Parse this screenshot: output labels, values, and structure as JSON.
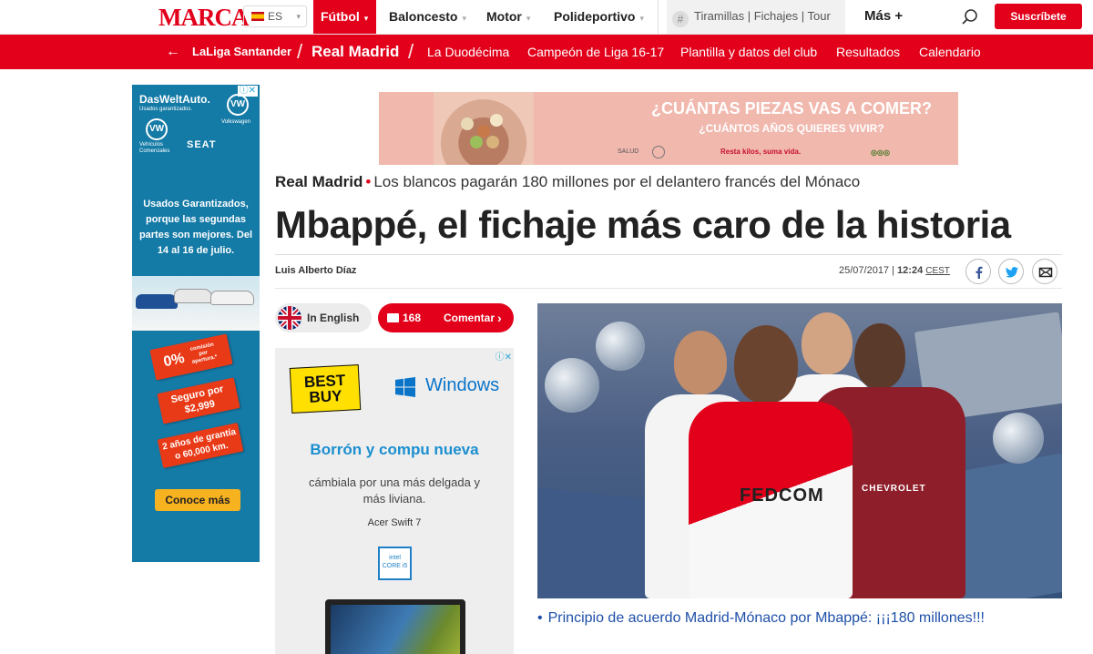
{
  "nav": {
    "logo": "MARCA",
    "lang": "ES",
    "items": [
      "Fútbol",
      "Baloncesto",
      "Motor",
      "Polideportivo"
    ],
    "trending": "Tiramillas | Fichajes | Tour",
    "more": "Más +",
    "subscribe": "Suscríbete"
  },
  "section_bar": {
    "league": "LaLiga Santander",
    "slash": "/",
    "team": "Real Madrid",
    "links": [
      "La Duodécima",
      "Campeón de Liga 16-17",
      "Plantilla y datos del club",
      "Resultados",
      "Calendario"
    ]
  },
  "ad_left": {
    "brand": "DasWeltAuto.",
    "brand_sub": "Usados garantizados.",
    "vw_logo": "VW",
    "vw_label": "Volkswagen",
    "vw_commercial": "Vehículos Comerciales",
    "seat": "SEAT",
    "promo": "Usados Garantizados, porque las segundas partes son mejores. Del 14 al 16 de julio.",
    "tag1": "0%",
    "tag1_sub": "comisión por apertura.*",
    "tag2": "Seguro por $2,999",
    "tag3": "2 años de grantía o 60,000 km.",
    "cta": "Conoce más"
  },
  "ad_top": {
    "headline": "¿CUÁNTAS PIEZAS VAS A COMER?",
    "subheadline": "¿CUÁNTOS AÑOS QUIERES VIVIR?",
    "tagline": "Resta kilos, suma vida.",
    "salud": "SALUD"
  },
  "article": {
    "section": "Real Madrid",
    "bullet": "•",
    "subtitle": "Los blancos pagarán 180 millones por el delantero francés del Mónaco",
    "headline": "Mbappé, el fichaje más caro de la historia",
    "author": "Luis Alberto Díaz",
    "date": "25/07/2017",
    "separator": "|",
    "time": "12:24",
    "tz": "CEST"
  },
  "pills": {
    "english": "In English",
    "comment_count": "168",
    "comment_label": "Comentar"
  },
  "ad_mid": {
    "bestbuy": "BEST BUY",
    "windows": "Windows",
    "headline": "Borrón y compu nueva",
    "body": "cámbiala por una más delgada y más liviana.",
    "model": "Acer Swift 7",
    "intel": "intel CORE i5"
  },
  "hero": {
    "sponsor1": "FEDCOM",
    "sponsor2": "CHEVROLET"
  },
  "related": {
    "bullet": "•",
    "text": "Principio de acuerdo Madrid-Mónaco por Mbappé: ¡¡¡180 millones!!!"
  },
  "colors": {
    "brand_red": "#e2001a",
    "link_blue": "#1e4fa8",
    "ad_blue": "#147aa6"
  }
}
